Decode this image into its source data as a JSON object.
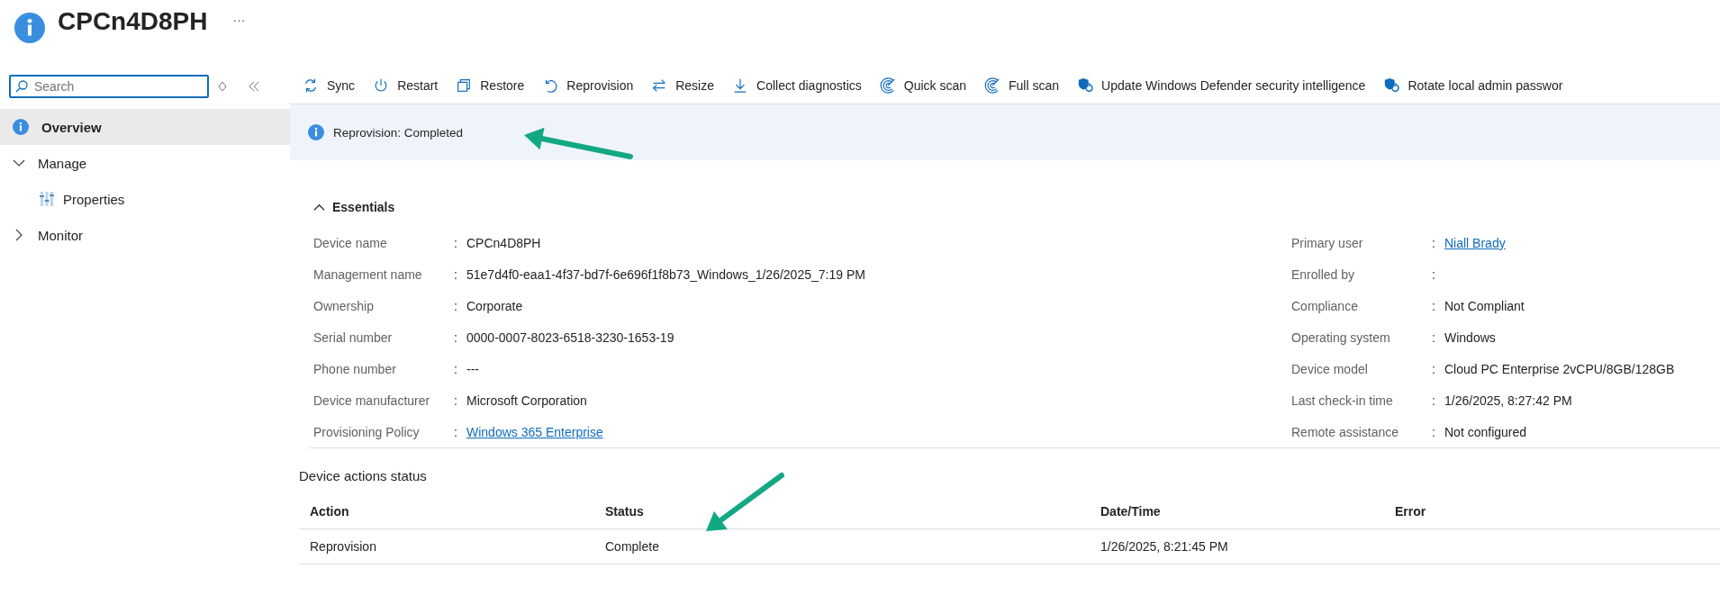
{
  "header": {
    "title": "CPCn4D8PH",
    "more": "···"
  },
  "sidebar": {
    "search": {
      "placeholder": "Search"
    },
    "items": [
      {
        "label": "Overview",
        "kind": "info",
        "selected": true
      },
      {
        "label": "Manage",
        "kind": "group",
        "expanded": true,
        "selected": false,
        "children": [
          {
            "label": "Properties",
            "kind": "properties",
            "selected": false
          }
        ]
      },
      {
        "label": "Monitor",
        "kind": "group",
        "expanded": false,
        "selected": false
      }
    ]
  },
  "toolbar": [
    {
      "label": "Sync",
      "kind": "sync"
    },
    {
      "label": "Restart",
      "kind": "power"
    },
    {
      "label": "Restore",
      "kind": "restore"
    },
    {
      "label": "Reprovision",
      "kind": "undo"
    },
    {
      "label": "Resize",
      "kind": "swap"
    },
    {
      "label": "Collect diagnostics",
      "kind": "download"
    },
    {
      "label": "Quick scan",
      "kind": "scan"
    },
    {
      "label": "Full scan",
      "kind": "scan"
    },
    {
      "label": "Update Windows Defender security intelligence",
      "kind": "shield"
    },
    {
      "label": "Rotate local admin passwor",
      "kind": "shield"
    }
  ],
  "banner": {
    "text": "Reprovision: Completed"
  },
  "essentials": {
    "title": "Essentials",
    "expanded": true,
    "left": [
      {
        "label": "Device name",
        "colon": ":",
        "value": "CPCn4D8PH"
      },
      {
        "label": "Management name",
        "colon": ":",
        "value": "51e7d4f0-eaa1-4f37-bd7f-6e696f1f8b73_Windows_1/26/2025_7:19 PM"
      },
      {
        "label": "Ownership",
        "colon": ":",
        "value": "Corporate"
      },
      {
        "label": "Serial number",
        "colon": ":",
        "value": "0000-0007-8023-6518-3230-1653-19"
      },
      {
        "label": "Phone number",
        "colon": ":",
        "value": "---"
      },
      {
        "label": "Device manufacturer",
        "colon": ":",
        "value": "Microsoft Corporation"
      },
      {
        "label": "Provisioning Policy",
        "colon": ":",
        "value": "Windows 365 Enterprise",
        "kind": "link"
      }
    ],
    "right": [
      {
        "label": "Primary user",
        "colon": ":",
        "value": "Niall Brady",
        "kind": "link"
      },
      {
        "label": "Enrolled by",
        "colon": ":"
      },
      {
        "label": "Compliance",
        "colon": ":",
        "value": "Not Compliant"
      },
      {
        "label": "Operating system",
        "colon": ":",
        "value": "Windows"
      },
      {
        "label": "Device model",
        "colon": ":",
        "value": "Cloud PC Enterprise 2vCPU/8GB/128GB"
      },
      {
        "label": "Last check-in time",
        "colon": ":",
        "value": "1/26/2025, 8:27:42 PM"
      },
      {
        "label": "Remote assistance",
        "colon": ":",
        "value": "Not configured"
      }
    ]
  },
  "actions_status": {
    "title": "Device actions status",
    "columns": [
      "Action",
      "Status",
      "Date/Time",
      "Error"
    ],
    "rows": [
      [
        "Reprovision",
        "Complete",
        "1/26/2025, 8:21:45 PM"
      ]
    ]
  },
  "annotations": [
    {
      "kind": "arrow"
    },
    {
      "kind": "arrow"
    }
  ]
}
